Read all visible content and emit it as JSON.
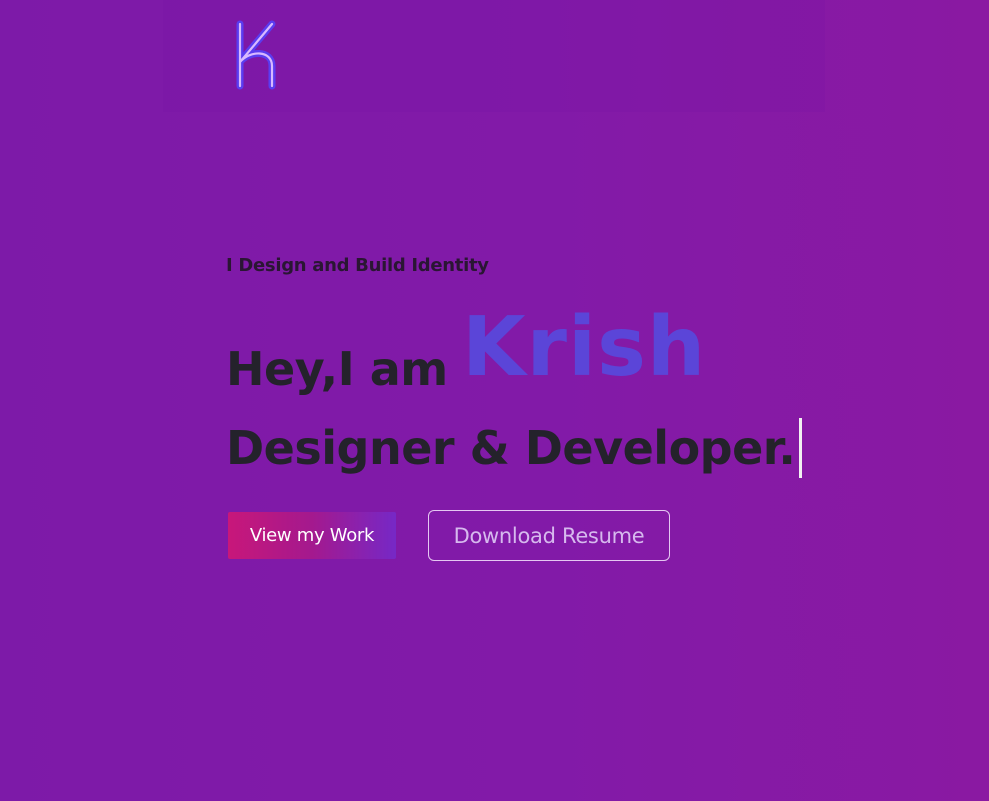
{
  "header": {
    "logo_icon": "k-monogram-icon",
    "logo_colors": {
      "outer": "#5a3cf0",
      "inner": "#d8b8ff"
    }
  },
  "hero": {
    "tagline": "I Design and Build Identity",
    "greeting": "Hey,I am",
    "name": "Krish",
    "role": "Designer & Developer."
  },
  "actions": {
    "primary_label": "View my Work",
    "secondary_label": "Download Resume"
  },
  "colors": {
    "background": "#821aa8",
    "name_accent": "#5b45d8",
    "heading_text": "#24222b",
    "primary_gradient_start": "#c8177a",
    "primary_gradient_end": "#7628c6",
    "outline_button": "#e5c8f2"
  }
}
